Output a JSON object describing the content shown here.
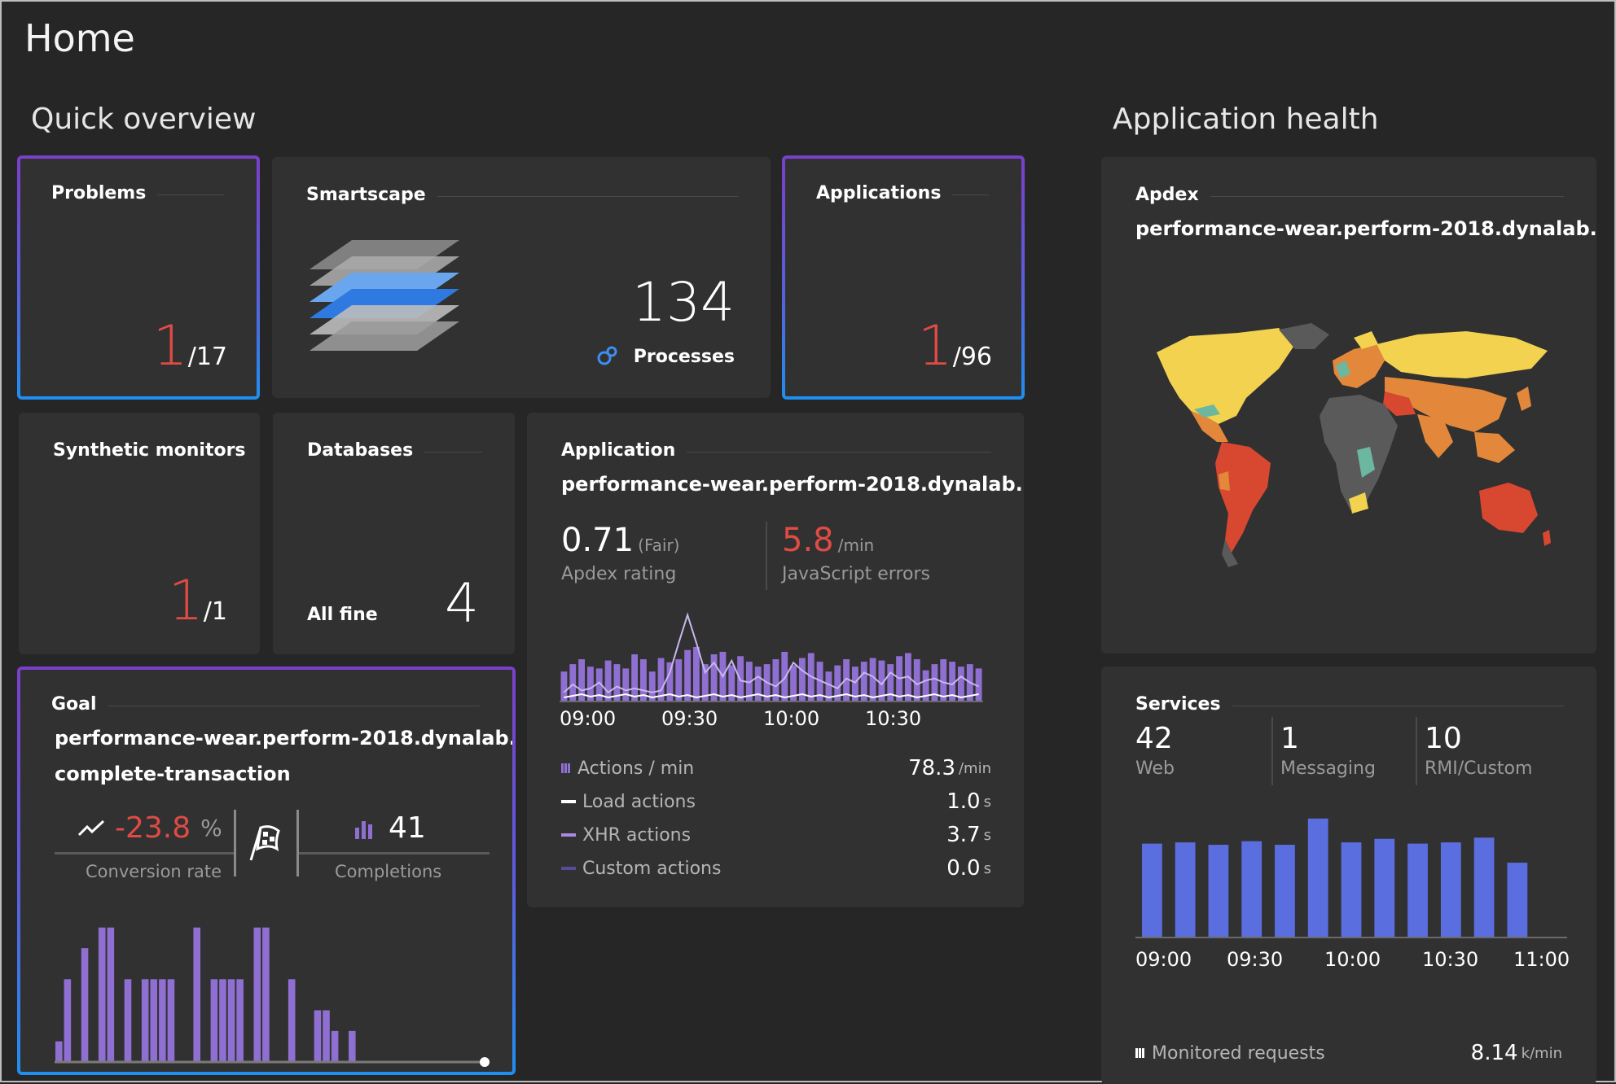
{
  "page": {
    "title": "Home"
  },
  "sections": {
    "quick_overview": "Quick overview",
    "application_health": "Application health"
  },
  "problems": {
    "title": "Problems",
    "count": "1",
    "total": "/17"
  },
  "smartscape": {
    "title": "Smartscape",
    "processes_count": "134",
    "processes_label": "Processes"
  },
  "applications": {
    "title": "Applications",
    "count": "1",
    "total": "/96"
  },
  "synthetic": {
    "title": "Synthetic monitors",
    "count": "1",
    "total": "/1"
  },
  "databases": {
    "title": "Databases",
    "status": "All fine",
    "count": "4"
  },
  "application": {
    "title": "Application",
    "name": "performance-wear.perform-2018.dynalab...",
    "apdex_value": "0.71",
    "apdex_qual": "(Fair)",
    "apdex_label": "Apdex rating",
    "js_errors_value": "5.8",
    "js_errors_unit": "/min",
    "js_errors_label": "JavaScript errors",
    "legend": [
      {
        "label": "Actions / min",
        "value": "78.3",
        "unit": "/min",
        "color": "#8f6fd1"
      },
      {
        "label": "Load actions",
        "value": "1.0",
        "unit": "s",
        "color": "#ffffff"
      },
      {
        "label": "XHR actions",
        "value": "3.7",
        "unit": "s",
        "color": "#a88be0"
      },
      {
        "label": "Custom actions",
        "value": "0.0",
        "unit": "s",
        "color": "#5a4a9a"
      }
    ]
  },
  "goal": {
    "title": "Goal",
    "name": "performance-wear.perform-2018.dynalab...",
    "transaction": "complete-transaction",
    "conversion_value": "-23.8",
    "conversion_unit": "%",
    "conversion_label": "Conversion rate",
    "completions_value": "41",
    "completions_label": "Completions"
  },
  "apdex_map": {
    "title": "Apdex",
    "name": "performance-wear.perform-2018.dynalab..."
  },
  "services": {
    "title": "Services",
    "stats": [
      {
        "value": "42",
        "label": "Web"
      },
      {
        "value": "1",
        "label": "Messaging"
      },
      {
        "value": "10",
        "label": "RMI/Custom"
      }
    ],
    "footer_label": "Monitored requests",
    "footer_value": "8.14",
    "footer_unit": "k/min"
  },
  "colors": {
    "accent_red": "#e04b44",
    "bar_purple": "#8f6fd1",
    "bar_blue": "#5b6ee0",
    "tile_bg": "#313131"
  },
  "chart_data": [
    {
      "type": "bar",
      "name": "application-actions",
      "x": [
        "09:00",
        "",
        "",
        "",
        "",
        "",
        "",
        "",
        "",
        "",
        "",
        "",
        "",
        "",
        "",
        "",
        "",
        "",
        "",
        "",
        "",
        "",
        "",
        "",
        ""
      ],
      "xticks": [
        "09:00",
        "09:30",
        "10:00",
        "10:30"
      ],
      "series": [
        {
          "name": "Actions / min",
          "values": [
            50,
            62,
            70,
            58,
            55,
            68,
            62,
            55,
            78,
            70,
            50,
            72,
            65,
            70,
            85,
            90,
            62,
            78,
            82,
            60,
            75,
            66,
            58,
            62,
            70,
            82,
            60,
            72,
            80,
            66,
            50,
            60,
            70,
            58,
            66,
            72,
            68,
            62,
            75,
            80,
            70,
            52,
            62,
            70,
            66,
            58,
            62,
            55
          ]
        },
        {
          "name": "Load actions",
          "values": [
            10,
            18,
            12,
            14,
            20,
            10,
            16,
            12,
            14,
            12,
            10,
            12,
            30,
            60,
            88,
            60,
            30,
            40,
            26,
            42,
            22,
            20,
            26,
            20,
            16,
            24,
            40,
            32,
            26,
            22,
            18,
            14,
            24,
            20,
            30,
            26,
            18,
            30,
            24,
            26,
            18,
            22,
            24,
            20,
            18,
            26,
            20,
            16
          ]
        }
      ]
    },
    {
      "type": "bar",
      "name": "goal-completions",
      "values": [
        2,
        8,
        0,
        11,
        0,
        13,
        13,
        0,
        8,
        0,
        8,
        8,
        8,
        8,
        0,
        0,
        13,
        0,
        8,
        8,
        8,
        8,
        0,
        13,
        13,
        0,
        0,
        8,
        0,
        0,
        5,
        5,
        3,
        0,
        3,
        0,
        0,
        0,
        0,
        0,
        0,
        0,
        0,
        0,
        0,
        0,
        0,
        0,
        0,
        0,
        0
      ]
    },
    {
      "type": "bar",
      "name": "services-requests",
      "categories": [
        "09:00",
        "",
        "",
        "",
        "09:30",
        "",
        "",
        "10:00",
        "",
        "",
        "10:30",
        "",
        "11:00"
      ],
      "xticks": [
        "09:00",
        "09:30",
        "10:00",
        "10:30",
        "11:00"
      ],
      "values": [
        7.8,
        7.9,
        7.7,
        8.0,
        7.7,
        9.9,
        7.9,
        8.2,
        7.8,
        7.9,
        8.3,
        6.2
      ]
    }
  ]
}
